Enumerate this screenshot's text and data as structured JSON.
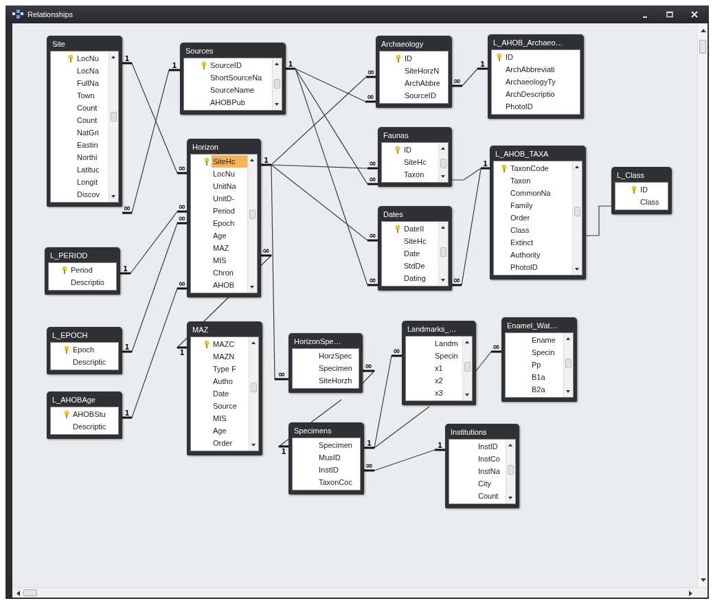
{
  "window": {
    "title": "Relationships"
  },
  "tables": [
    {
      "title": "Site",
      "scrollable": true,
      "fields": [
        {
          "name": "LocNu",
          "key": true,
          "selected": false
        },
        {
          "name": "LocNa",
          "key": false,
          "selected": false
        },
        {
          "name": "FullNa",
          "key": false,
          "selected": false
        },
        {
          "name": "Town",
          "key": false,
          "selected": false
        },
        {
          "name": "Count",
          "key": false,
          "selected": false
        },
        {
          "name": "Count",
          "key": false,
          "selected": false
        },
        {
          "name": "NatGri",
          "key": false,
          "selected": false
        },
        {
          "name": "Eastin",
          "key": false,
          "selected": false
        },
        {
          "name": "Northi",
          "key": false,
          "selected": false
        },
        {
          "name": "Latituc",
          "key": false,
          "selected": false
        },
        {
          "name": "Longit",
          "key": false,
          "selected": false
        },
        {
          "name": "Discov",
          "key": false,
          "selected": false
        }
      ]
    },
    {
      "title": "Sources",
      "scrollable": true,
      "fields": [
        {
          "name": "SourceID",
          "key": true,
          "selected": false
        },
        {
          "name": "ShortSourceNa",
          "key": false,
          "selected": false
        },
        {
          "name": "SourceName",
          "key": false,
          "selected": false
        },
        {
          "name": "AHOBPub",
          "key": false,
          "selected": false
        }
      ]
    },
    {
      "title": "Archaeology",
      "scrollable": false,
      "fields": [
        {
          "name": "ID",
          "key": true,
          "selected": false
        },
        {
          "name": "SiteHorzN",
          "key": false,
          "selected": false
        },
        {
          "name": "ArchAbbre",
          "key": false,
          "selected": false
        },
        {
          "name": "SourceID",
          "key": false,
          "selected": false
        }
      ]
    },
    {
      "title": "L_AHOB_Archaeo…",
      "scrollable": false,
      "fields": [
        {
          "name": "ID",
          "key": true,
          "selected": false
        },
        {
          "name": "ArchAbbreviati",
          "key": false,
          "selected": false
        },
        {
          "name": "ArchaeologyTy",
          "key": false,
          "selected": false
        },
        {
          "name": "ArchDescriptio",
          "key": false,
          "selected": false
        },
        {
          "name": "PhotoID",
          "key": false,
          "selected": false
        }
      ]
    },
    {
      "title": "Horizon",
      "scrollable": true,
      "fields": [
        {
          "name": "SiteHc",
          "key": true,
          "selected": true
        },
        {
          "name": "LocNu",
          "key": false,
          "selected": false
        },
        {
          "name": "UnitNa",
          "key": false,
          "selected": false
        },
        {
          "name": "UnitD-",
          "key": false,
          "selected": false
        },
        {
          "name": "Period",
          "key": false,
          "selected": false
        },
        {
          "name": "Epoch",
          "key": false,
          "selected": false
        },
        {
          "name": "Age",
          "key": false,
          "selected": false
        },
        {
          "name": "MAZ",
          "key": false,
          "selected": false
        },
        {
          "name": "MIS",
          "key": false,
          "selected": false
        },
        {
          "name": "Chron",
          "key": false,
          "selected": false
        },
        {
          "name": "AHOB",
          "key": false,
          "selected": false
        }
      ]
    },
    {
      "title": "Faunas",
      "scrollable": true,
      "fields": [
        {
          "name": "ID",
          "key": true,
          "selected": false
        },
        {
          "name": "SiteHc",
          "key": false,
          "selected": false
        },
        {
          "name": "Taxon",
          "key": false,
          "selected": false
        }
      ]
    },
    {
      "title": "L_AHOB_TAXA",
      "scrollable": true,
      "fields": [
        {
          "name": "TaxonCode",
          "key": true,
          "selected": false
        },
        {
          "name": "Taxon",
          "key": false,
          "selected": false
        },
        {
          "name": "CommonNa",
          "key": false,
          "selected": false
        },
        {
          "name": "Family",
          "key": false,
          "selected": false
        },
        {
          "name": "Order",
          "key": false,
          "selected": false
        },
        {
          "name": "Class",
          "key": false,
          "selected": false
        },
        {
          "name": "Extinct",
          "key": false,
          "selected": false
        },
        {
          "name": "Authority",
          "key": false,
          "selected": false
        },
        {
          "name": "PhotoID",
          "key": false,
          "selected": false
        }
      ]
    },
    {
      "title": "L_Class",
      "scrollable": false,
      "fields": [
        {
          "name": "ID",
          "key": true,
          "selected": false
        },
        {
          "name": "Class",
          "key": false,
          "selected": false
        }
      ]
    },
    {
      "title": "Dates",
      "scrollable": true,
      "fields": [
        {
          "name": "DateII",
          "key": true,
          "selected": false
        },
        {
          "name": "SiteHc",
          "key": false,
          "selected": false
        },
        {
          "name": "Date",
          "key": false,
          "selected": false
        },
        {
          "name": "StdDe",
          "key": false,
          "selected": false
        },
        {
          "name": "Dating",
          "key": false,
          "selected": false
        }
      ]
    },
    {
      "title": "L_PERIOD",
      "scrollable": false,
      "fields": [
        {
          "name": "Period",
          "key": true,
          "selected": false
        },
        {
          "name": "Descriptio",
          "key": false,
          "selected": false
        }
      ]
    },
    {
      "title": "L_EPOCH",
      "scrollable": false,
      "fields": [
        {
          "name": "Epoch",
          "key": true,
          "selected": false
        },
        {
          "name": "Descriptic",
          "key": false,
          "selected": false
        }
      ]
    },
    {
      "title": "MAZ",
      "scrollable": true,
      "fields": [
        {
          "name": "MAZC",
          "key": true,
          "selected": false
        },
        {
          "name": "MAZN",
          "key": false,
          "selected": false
        },
        {
          "name": "Type F",
          "key": false,
          "selected": false
        },
        {
          "name": "Autho",
          "key": false,
          "selected": false
        },
        {
          "name": "Date",
          "key": false,
          "selected": false
        },
        {
          "name": "Source",
          "key": false,
          "selected": false
        },
        {
          "name": "MIS",
          "key": false,
          "selected": false
        },
        {
          "name": "Age",
          "key": false,
          "selected": false
        },
        {
          "name": "Order",
          "key": false,
          "selected": false
        }
      ]
    },
    {
      "title": "HorizonSpe…",
      "scrollable": false,
      "fields": [
        {
          "name": "HorzSpec",
          "key": false,
          "selected": false
        },
        {
          "name": "Specimen",
          "key": false,
          "selected": false
        },
        {
          "name": "SiteHorzh",
          "key": false,
          "selected": false
        }
      ]
    },
    {
      "title": "Landmarks_…",
      "scrollable": true,
      "fields": [
        {
          "name": "Landm",
          "key": false,
          "selected": false
        },
        {
          "name": "Specin",
          "key": false,
          "selected": false
        },
        {
          "name": "x1",
          "key": false,
          "selected": false
        },
        {
          "name": "x2",
          "key": false,
          "selected": false
        },
        {
          "name": "x3",
          "key": false,
          "selected": false
        }
      ]
    },
    {
      "title": "Enamel_Wat…",
      "scrollable": true,
      "fields": [
        {
          "name": "Ename",
          "key": false,
          "selected": false
        },
        {
          "name": "Specin",
          "key": false,
          "selected": false
        },
        {
          "name": "Pp",
          "key": false,
          "selected": false
        },
        {
          "name": "B1a",
          "key": false,
          "selected": false
        },
        {
          "name": "B2a",
          "key": false,
          "selected": false
        }
      ]
    },
    {
      "title": "L_AHOBAge",
      "scrollable": false,
      "fields": [
        {
          "name": "AHOBStu",
          "key": true,
          "selected": false
        },
        {
          "name": "Descriptic",
          "key": false,
          "selected": false
        }
      ]
    },
    {
      "title": "Specimens",
      "scrollable": false,
      "fields": [
        {
          "name": "Specimen",
          "key": false,
          "selected": false
        },
        {
          "name": "MusID",
          "key": false,
          "selected": false
        },
        {
          "name": "InstID",
          "key": false,
          "selected": false
        },
        {
          "name": "TaxonCoc",
          "key": false,
          "selected": false
        }
      ]
    },
    {
      "title": "Institutions",
      "scrollable": true,
      "fields": [
        {
          "name": "InstID",
          "key": false,
          "selected": false
        },
        {
          "name": "InstCo",
          "key": false,
          "selected": false
        },
        {
          "name": "InstNa",
          "key": false,
          "selected": false
        },
        {
          "name": "City",
          "key": false,
          "selected": false
        },
        {
          "name": "Count",
          "key": false,
          "selected": false
        }
      ]
    }
  ],
  "relationships": [
    {
      "kind": "link",
      "end_a": "1",
      "end_b": "∞"
    },
    {
      "kind": "link",
      "end_a": "∞",
      "end_b": "1"
    },
    {
      "kind": "link",
      "end_a": "1",
      "end_b": "∞"
    },
    {
      "kind": "link",
      "end_a": "1",
      "end_b": "∞"
    },
    {
      "kind": "link",
      "end_b": "∞"
    },
    {
      "kind": "link",
      "end_a": "1",
      "end_b": "∞"
    },
    {
      "kind": "link",
      "end_b": "∞"
    },
    {
      "kind": "link",
      "end_b": "1"
    },
    {
      "kind": "link",
      "end_b": "∞"
    },
    {
      "kind": "link",
      "end_b": "∞"
    },
    {
      "kind": "link"
    },
    {
      "kind": "link",
      "end_a": "∞"
    },
    {
      "kind": "link",
      "end_a": "1",
      "end_b": "∞"
    },
    {
      "kind": "link",
      "end_b": "∞"
    },
    {
      "kind": "link",
      "end_a": "1",
      "end_b": "∞"
    },
    {
      "kind": "link",
      "end_a": "1",
      "end_b": "∞"
    },
    {
      "kind": "link",
      "end_a": "1",
      "end_b": "∞"
    },
    {
      "kind": "link",
      "end_b": "∞"
    },
    {
      "kind": "link",
      "end_a": "∞"
    },
    {
      "kind": "link",
      "end_a": "1",
      "end_b": "∞"
    },
    {
      "kind": "link",
      "end_a": "1"
    },
    {
      "kind": "link"
    },
    {
      "kind": "link",
      "end_a": "∞",
      "end_b": "1"
    }
  ]
}
